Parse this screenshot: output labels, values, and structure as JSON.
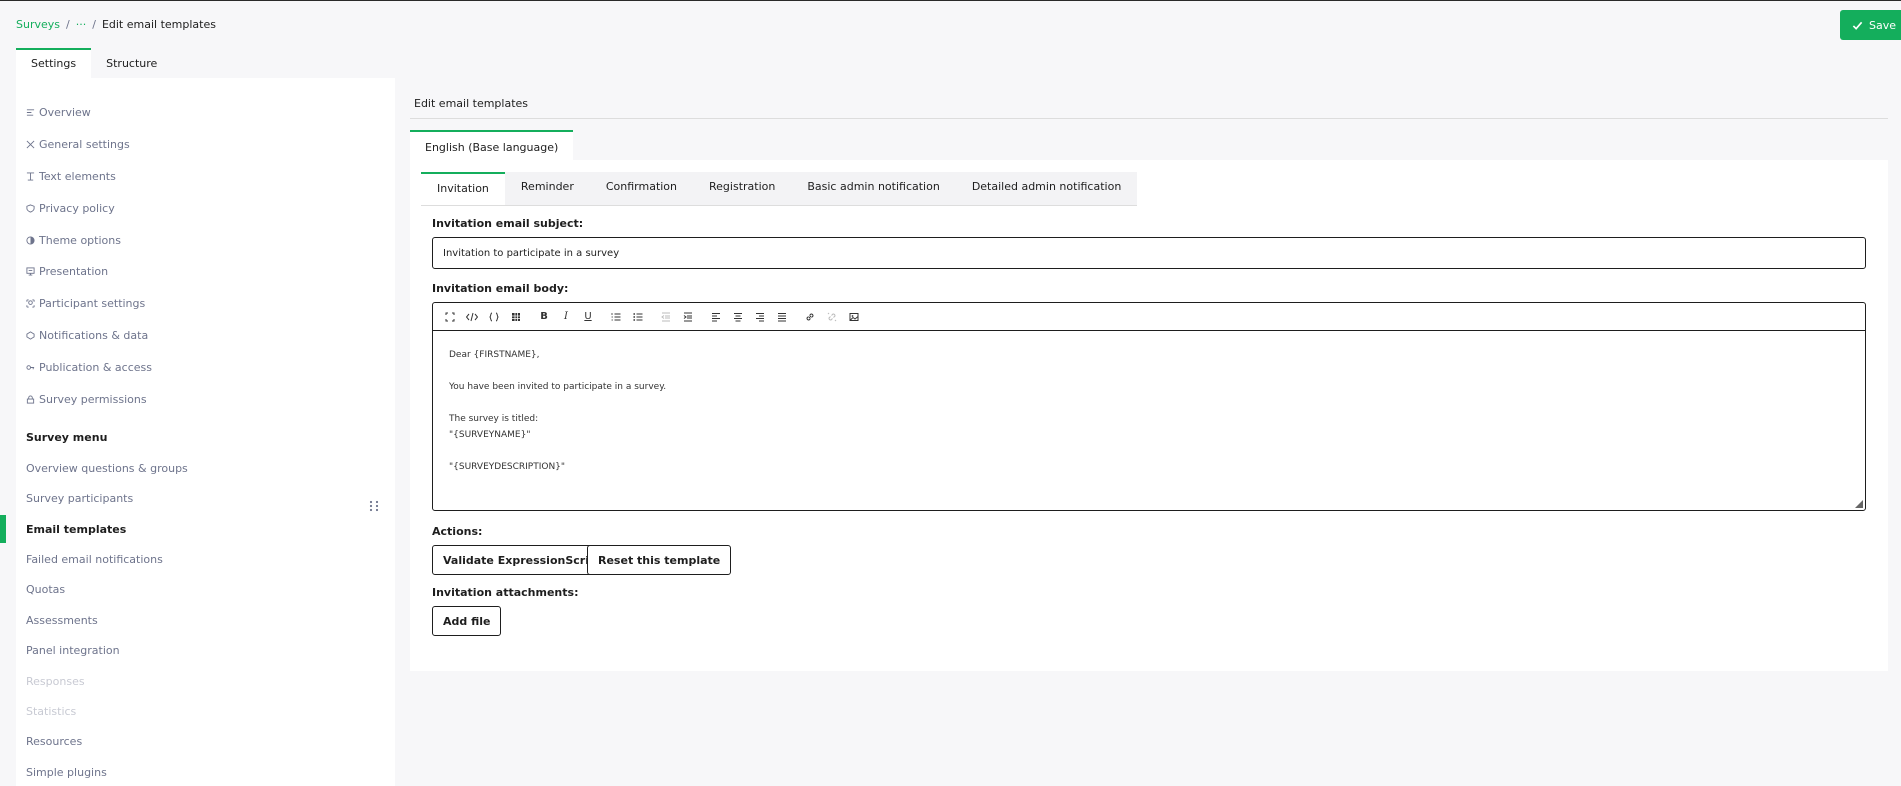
{
  "breadcrumb": {
    "root": "Surveys",
    "ellipsis": "···",
    "current": "Edit email templates"
  },
  "save_button": "Save",
  "top_tabs": [
    "Settings",
    "Structure"
  ],
  "sidebar": {
    "settings_items": [
      {
        "label": "Overview",
        "icon": "overview-icon"
      },
      {
        "label": "General settings",
        "icon": "tools-icon"
      },
      {
        "label": "Text elements",
        "icon": "text-icon"
      },
      {
        "label": "Privacy policy",
        "icon": "shield-icon"
      },
      {
        "label": "Theme options",
        "icon": "palette-icon"
      },
      {
        "label": "Presentation",
        "icon": "presentation-icon"
      },
      {
        "label": "Participant settings",
        "icon": "participant-icon"
      },
      {
        "label": "Notifications & data",
        "icon": "notification-icon"
      },
      {
        "label": "Publication & access",
        "icon": "key-icon"
      },
      {
        "label": "Survey permissions",
        "icon": "lock-icon"
      }
    ],
    "menu_title": "Survey menu",
    "menu_items": [
      "Overview questions & groups",
      "Survey participants",
      "Email templates",
      "Failed email notifications",
      "Quotas",
      "Assessments",
      "Panel integration",
      "Responses",
      "Statistics",
      "Resources",
      "Simple plugins"
    ]
  },
  "main": {
    "header": "Edit email templates",
    "language_tab": "English (Base language)",
    "template_tabs": [
      "Invitation",
      "Reminder",
      "Confirmation",
      "Registration",
      "Basic admin notification",
      "Detailed admin notification"
    ],
    "subject_label": "Invitation email subject:",
    "subject_value": "Invitation to participate in a survey",
    "body_label": "Invitation email body:",
    "body_lines": [
      "Dear {FIRSTNAME},",
      "",
      "You have been invited to participate in a survey.",
      "",
      "The survey is titled:",
      "\"{SURVEYNAME}\"",
      "",
      "\"{SURVEYDESCRIPTION}\""
    ],
    "actions_label": "Actions:",
    "validate_button": "Validate ExpressionScript",
    "reset_button": "Reset this template",
    "attachments_label": "Invitation attachments:",
    "add_file_button": "Add file"
  },
  "colors": {
    "accent": "#14ae5c",
    "text": "#1e1e1e",
    "muted": "#6e748c",
    "disabled": "#c8cad3"
  }
}
